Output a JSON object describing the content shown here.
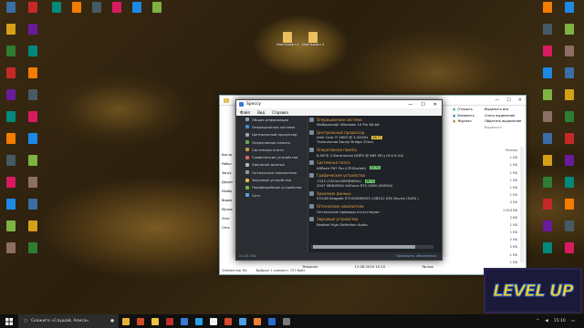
{
  "desktop": {
    "left_icons": [
      "",
      "",
      "",
      "",
      "",
      "",
      "",
      "",
      "",
      "",
      "",
      ""
    ],
    "top_icons": [
      "",
      "",
      "",
      "",
      "",
      ""
    ],
    "center_icons": [
      "Майнкрафт Форумы",
      "Майнкрафт Форумы"
    ],
    "colors": [
      "#3a6ea5",
      "#d4a017",
      "#2e7d32",
      "#c62828",
      "#6a1b9a",
      "#00897b",
      "#f57c00",
      "#455a64",
      "#d81b60",
      "#1e88e5",
      "#7cb342",
      "#8d6e63"
    ]
  },
  "explorer": {
    "ribbon": [
      "Открыть",
      "Изменить",
      "Журнал",
      "Выделить все",
      "Снять выделение",
      "Обратить выделение"
    ],
    "ribbon_extra": [
      "Выделить"
    ],
    "left_nav": [
      "Быстр",
      "Рабоч",
      "Загру",
      "Докум",
      "Изобр",
      "Видео",
      "Музык",
      "Этот",
      "Сеть"
    ],
    "right_header": "Размер",
    "right_sizes": [
      "1 КБ",
      "1 КБ",
      "1 КБ",
      "1 КБ",
      "1 КБ",
      "1 КБ",
      "2 КБ",
      "1 024 КБ",
      "2 КБ",
      "1 КБ",
      "1 КБ",
      "2 КБ",
      "2 КБ",
      "1 КБ",
      "1 КБ"
    ],
    "status_left": "Элементов: 84",
    "status_sel": "Выбран 1 элемент: 727 байт",
    "telegram": "Telegram",
    "date": "13.08.2019 15:10",
    "type": "Ярлык"
  },
  "speccy": {
    "title": "Speccy",
    "menu": [
      "Файл",
      "Вид",
      "Справка"
    ],
    "nav": [
      {
        "label": "Общая информация",
        "color": "#8aa0b5"
      },
      {
        "label": "Операционная система",
        "color": "#3e8ed0"
      },
      {
        "label": "Центральный процессор",
        "color": "#9aa7b4"
      },
      {
        "label": "Оперативная память",
        "color": "#6aa84f"
      },
      {
        "label": "Системная плата",
        "color": "#c49a3a"
      },
      {
        "label": "Графические устройства",
        "color": "#e06666"
      },
      {
        "label": "Хранение данных",
        "color": "#b7b7b7"
      },
      {
        "label": "Оптические накопители",
        "color": "#999999"
      },
      {
        "label": "Звуковые устройства",
        "color": "#e6b84a"
      },
      {
        "label": "Периферийные устройства",
        "color": "#7cb342"
      },
      {
        "label": "Сеть",
        "color": "#5aa0e0"
      }
    ],
    "sections": [
      {
        "head": "Операционная система",
        "lines": [
          "Майкрософт Windows 10 Pro 64-bit"
        ]
      },
      {
        "head": "Центральный процессор",
        "lines": [
          "Intel Core i7 2600 @ 3.40GHz",
          "Технология Sandy Bridge 32nm"
        ],
        "temp": "46 °C",
        "temp_color": "#e0c040"
      },
      {
        "head": "Оперативная память",
        "lines": [
          "8,00ГБ 2-Канальная DDR3 @ 665 МГц (9-9-9-24)"
        ]
      },
      {
        "head": "Системная плата",
        "lines": [
          "ASRock P67 Pro (CPUSocket)"
        ],
        "temp": "27 °C",
        "temp_color": "#6cc06c"
      },
      {
        "head": "Графические устройства",
        "lines": [
          "1343 (1920x1080@60Hz)",
          "2047 МБNVIDIA GeForce RTX 2060 (NVIDIA)"
        ],
        "temp": "29 °C",
        "temp_color": "#6cc06c"
      },
      {
        "head": "Хранение данных",
        "lines": [
          "931GB Seagate ST1000DM003-1SB102 ATA Device (SATA )"
        ]
      },
      {
        "head": "Оптические накопители",
        "lines": [
          "Оптические приводы отсутствуют"
        ]
      },
      {
        "head": "Звуковые устройства",
        "lines": [
          "Realtek High Definition Audio"
        ]
      }
    ],
    "version": "v1.32.740",
    "update": "Проверить обновления"
  },
  "taskbar": {
    "search_placeholder": "Скажите «Слушай, Алиса»",
    "apps": [
      "#e8b23a",
      "#d04a2a",
      "#f0c040",
      "#c03030",
      "#3a7bd5",
      "#2aa0e0",
      "#f0f0f0",
      "#d84a2a",
      "#4aa0e8",
      "#f08030",
      "#2a6ad0",
      "#7a7a7a"
    ],
    "time": "15:10"
  },
  "overlay": {
    "logo": "LEVEL UP"
  }
}
